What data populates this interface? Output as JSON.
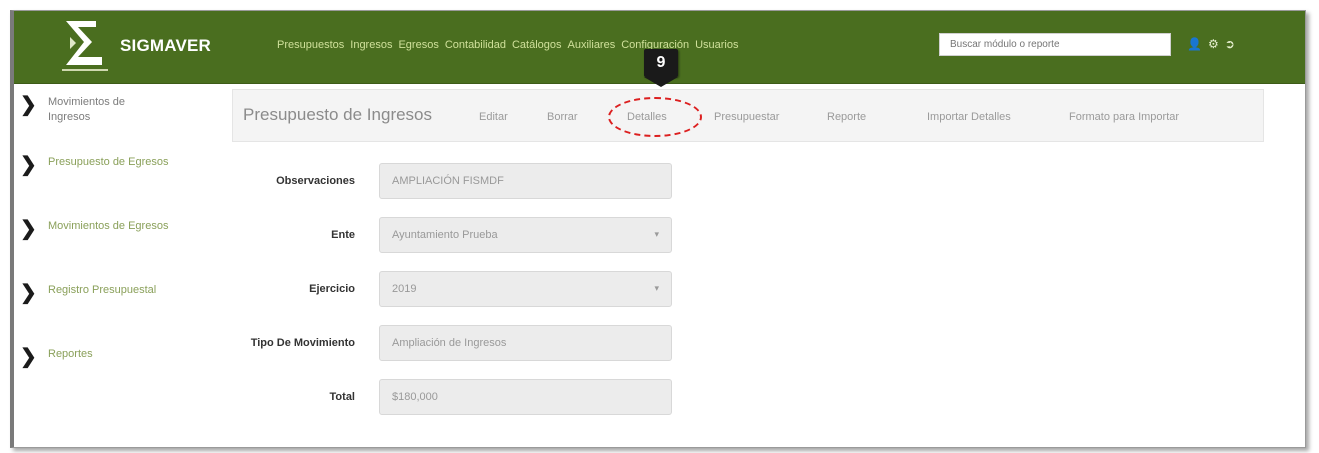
{
  "header": {
    "brand": "SIGMAVER",
    "nav": [
      "Presupuestos",
      "Ingresos",
      "Egresos",
      "Contabilidad",
      "Catálogos",
      "Auxiliares",
      "Configuración",
      "Usuarios"
    ],
    "search_placeholder": "Buscar módulo o reporte",
    "icons": [
      "user-icon",
      "gear-icon",
      "logout-icon"
    ],
    "colors": {
      "bar": "#4a6e1f",
      "nav_text": "#cfe09a"
    }
  },
  "annotation": {
    "badge": "9",
    "callout_color": "#dc1f1f"
  },
  "sidebar": {
    "items": [
      {
        "label_line1": "Movimientos de",
        "label_line2": "Ingresos",
        "active": true
      },
      {
        "label_line1": "Presupuesto de Egresos"
      },
      {
        "label_line1": "Movimientos de Egresos"
      },
      {
        "label_line1": "Registro Presupuestal"
      },
      {
        "label_line1": "Reportes"
      }
    ]
  },
  "tabs": {
    "title": "Presupuesto de Ingresos",
    "items": [
      "Editar",
      "Borrar",
      "Detalles",
      "Presupuestar",
      "Reporte",
      "Importar Detalles",
      "Formato para Importar"
    ]
  },
  "form": {
    "fields": [
      {
        "label": "Observaciones",
        "value": "AMPLIACIÓN FISMDF"
      },
      {
        "label": "Ente",
        "value": "Ayuntamiento Prueba"
      },
      {
        "label": "Ejercicio",
        "value": "2019"
      },
      {
        "label": "Tipo De Movimiento",
        "value": "Ampliación de Ingresos"
      },
      {
        "label": "Total",
        "value": "$180,000"
      }
    ]
  }
}
